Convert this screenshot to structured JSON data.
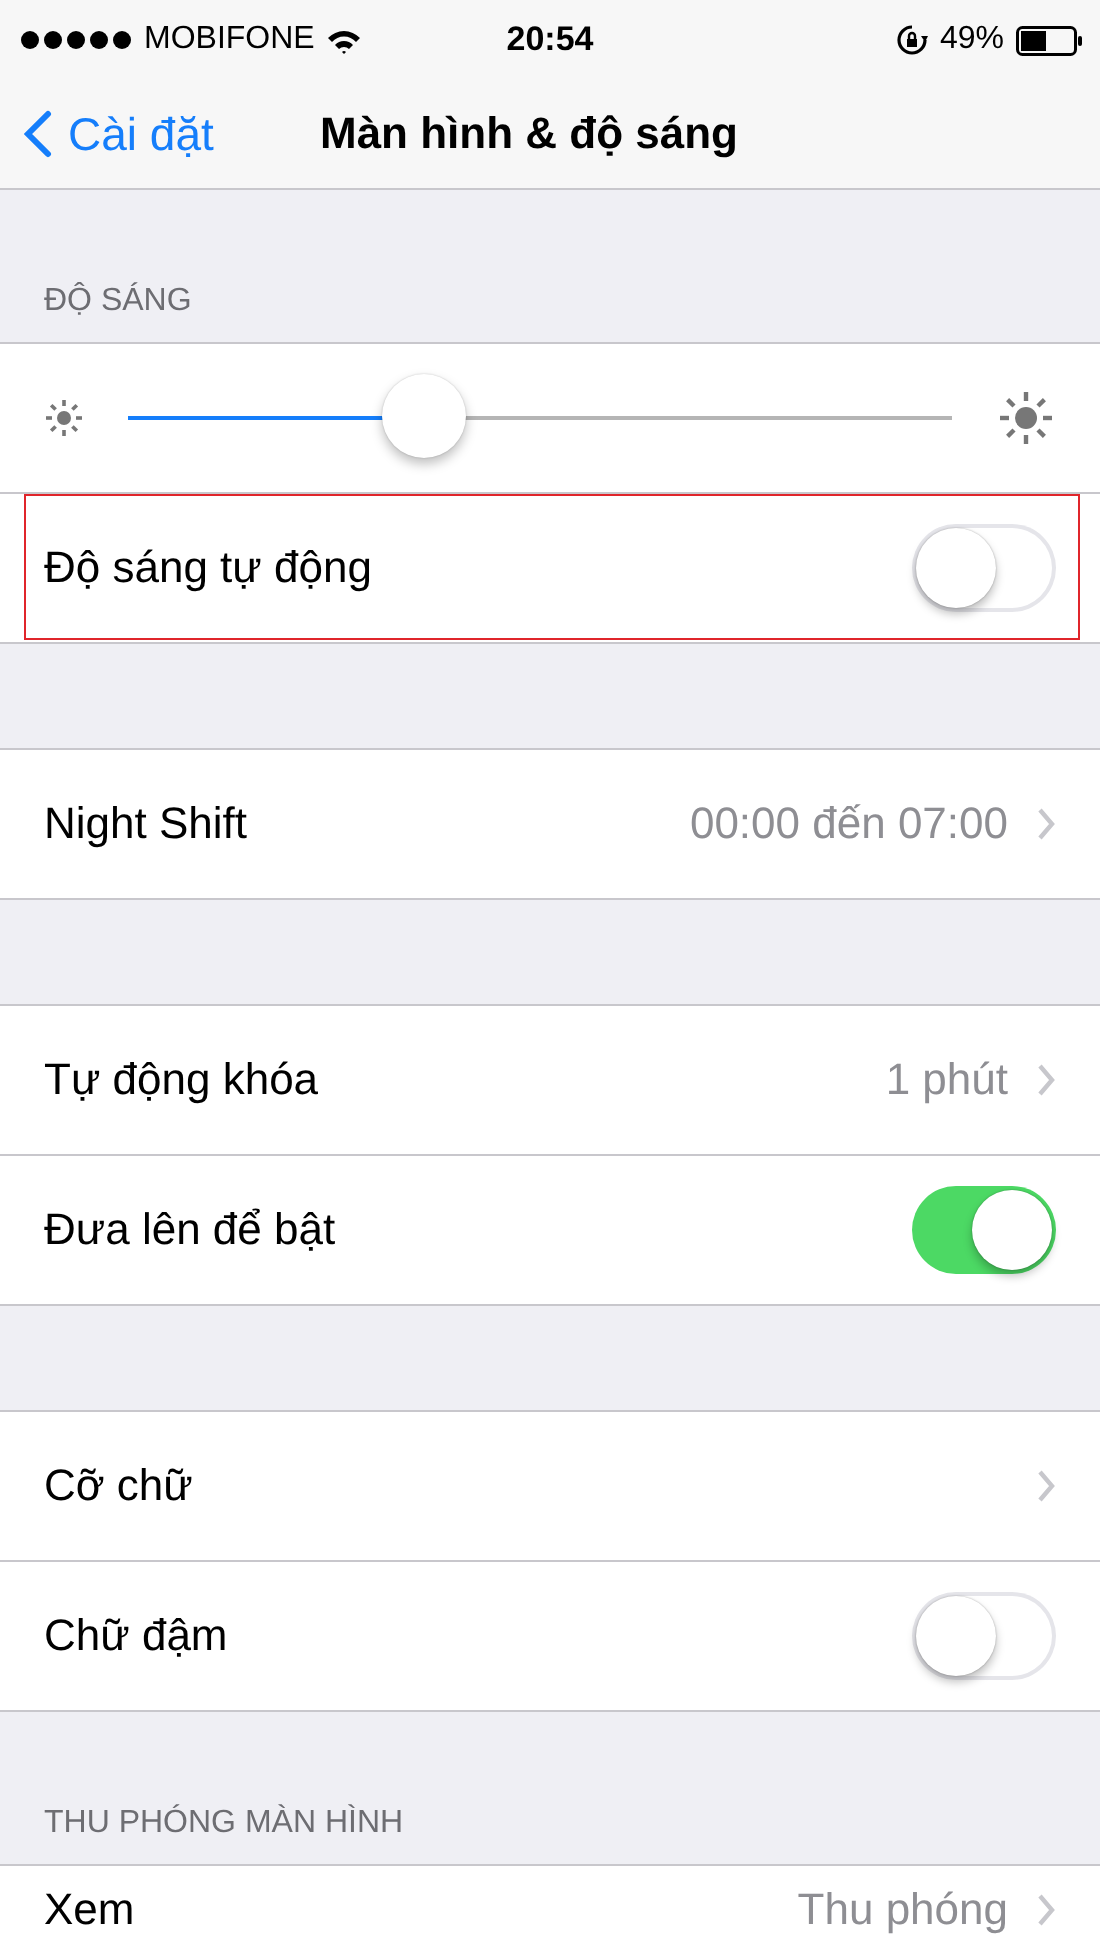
{
  "status_bar": {
    "carrier": "MOBIFONE",
    "time": "20:54",
    "battery": "49%"
  },
  "nav": {
    "back": "Cài đặt",
    "title": "Màn hình & độ sáng"
  },
  "sections": [
    {
      "header": "ĐỘ SÁNG",
      "rows": [
        {
          "kind": "slider",
          "level": 0.36
        },
        {
          "kind": "toggle",
          "label": "Độ sáng tự động",
          "on": false,
          "highlighted": true
        }
      ]
    },
    {
      "rows": [
        {
          "kind": "link",
          "label": "Night Shift",
          "value": "00:00 đến 07:00"
        }
      ]
    },
    {
      "rows": [
        {
          "kind": "link",
          "label": "Tự động khóa",
          "value": "1 phút"
        },
        {
          "kind": "toggle",
          "label": "Đưa lên để bật",
          "on": true,
          "highlighted": false
        }
      ]
    },
    {
      "rows": [
        {
          "kind": "link",
          "label": "Cỡ chữ"
        },
        {
          "kind": "toggle",
          "label": "Chữ đậm",
          "on": false,
          "highlighted": false
        }
      ]
    },
    {
      "header": "THU PHÓNG MÀN HÌNH",
      "rows": [
        {
          "kind": "link",
          "label": "Xem",
          "value": "Thu phóng"
        }
      ]
    }
  ]
}
